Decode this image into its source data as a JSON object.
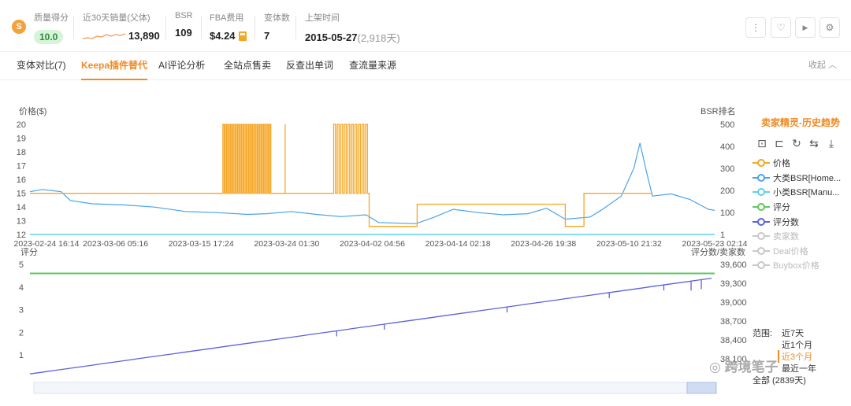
{
  "stats": {
    "logo_glyph": "S",
    "quality": {
      "label": "质量得分",
      "value": "10.0"
    },
    "sales": {
      "label": "近30天销量(父体)",
      "value": "13,890"
    },
    "bsr": {
      "label": "BSR",
      "value": "109"
    },
    "fba": {
      "label": "FBA费用",
      "value": "$4.24"
    },
    "variants": {
      "label": "变体数",
      "value": "7"
    },
    "listing": {
      "label": "上架时间",
      "date": "2015-05-27",
      "days": "(2,918天)"
    }
  },
  "actions": [
    {
      "name": "more-icon",
      "glyph": "⋮"
    },
    {
      "name": "heart-icon",
      "glyph": "♡"
    },
    {
      "name": "video-icon",
      "glyph": "▶"
    },
    {
      "name": "gear-icon",
      "glyph": "⚙"
    }
  ],
  "tabs": [
    {
      "label": "变体对比(7)",
      "active": false
    },
    {
      "label": "Keepa插件替代",
      "active": true
    },
    {
      "label": "AI评论分析",
      "active": false
    },
    {
      "label": "全站点售卖",
      "active": false
    },
    {
      "label": "反查出单词",
      "active": false
    },
    {
      "label": "查流量来源",
      "active": false
    }
  ],
  "collapse_label": "收起",
  "legend": {
    "title": "卖家精灵-历史趋势",
    "items": [
      {
        "label": "价格",
        "color": "#f5a623",
        "on": true
      },
      {
        "label": "大类BSR[Home...",
        "color": "#4aa3ea",
        "on": true
      },
      {
        "label": "小类BSR[Manu...",
        "color": "#5fd0e8",
        "on": true
      },
      {
        "label": "评分",
        "color": "#5cc95c",
        "on": true
      },
      {
        "label": "评分数",
        "color": "#5a62dc",
        "on": true
      },
      {
        "label": "卖家数",
        "color": "#c8c8c8",
        "on": false
      },
      {
        "label": "Deal价格",
        "color": "#c8c8c8",
        "on": false
      },
      {
        "label": "Buybox价格",
        "color": "#c8c8c8",
        "on": false
      }
    ]
  },
  "range": {
    "label": "范围:",
    "options": [
      {
        "label": "近7天",
        "selected": false
      },
      {
        "label": "近1个月",
        "selected": false
      },
      {
        "label": "近3个月",
        "selected": true
      },
      {
        "label": "最近一年",
        "selected": false
      },
      {
        "label": "全部 (2839天)",
        "selected": false
      }
    ]
  },
  "watermark": "跨境笔子",
  "chart_data": [
    {
      "type": "line",
      "ylabel": "价格($)",
      "y2label": "BSR排名",
      "x_ticks": [
        "2023-02-24 16:14",
        "2023-03-06 05:16",
        "2023-03-15 17:24",
        "2023-03-24 01:30",
        "2023-04-02 04:56",
        "2023-04-14 02:18",
        "2023-04-26 19:38",
        "2023-05-10 21:32",
        "2023-05-23 02:14"
      ],
      "xlim": [
        "2023-02-24 16:14",
        "2023-05-23 02:14"
      ],
      "ylim": [
        12,
        20
      ],
      "y_ticks": [
        "12",
        "13",
        "14",
        "15",
        "16",
        "17",
        "18",
        "19",
        "20"
      ],
      "y2lim": [
        1,
        500
      ],
      "y2_ticks": [
        "1",
        "100",
        "200",
        "300",
        "400",
        "500"
      ],
      "series": [
        {
          "name": "价格",
          "axis": "left",
          "color": "#f5a623",
          "segments": [
            {
              "from": 0,
              "to": 0.31,
              "value": 14.99
            },
            {
              "from": 0.31,
              "to": 0.389,
              "value": 14.99,
              "spikes_to": 20,
              "count": 20
            },
            {
              "from": 0.389,
              "to": 0.488,
              "value": 14.99
            },
            {
              "from": 0.488,
              "to": 0.545,
              "value": 14.99,
              "spikes_to": 20,
              "count": 10
            },
            {
              "from": 0.545,
              "to": 0.622,
              "value": 12.59
            },
            {
              "from": 0.622,
              "to": 0.86,
              "value": 14.2
            },
            {
              "from": 0.86,
              "to": 0.89,
              "value": 12.59
            },
            {
              "from": 0.89,
              "to": 1.0,
              "value": 14.99
            }
          ],
          "extra_spike_at": 0.41
        },
        {
          "name": "大类BSR[Home...",
          "axis": "right",
          "color": "#4aa3ea",
          "points": [
            [
              0,
              195
            ],
            [
              0.02,
              205
            ],
            [
              0.05,
              195
            ],
            [
              0.065,
              155
            ],
            [
              0.1,
              140
            ],
            [
              0.15,
              135
            ],
            [
              0.2,
              125
            ],
            [
              0.25,
              105
            ],
            [
              0.3,
              100
            ],
            [
              0.35,
              92
            ],
            [
              0.38,
              95
            ],
            [
              0.42,
              105
            ],
            [
              0.46,
              92
            ],
            [
              0.5,
              82
            ],
            [
              0.54,
              90
            ],
            [
              0.56,
              55
            ],
            [
              0.62,
              50
            ],
            [
              0.65,
              80
            ],
            [
              0.68,
              115
            ],
            [
              0.72,
              100
            ],
            [
              0.76,
              90
            ],
            [
              0.8,
              95
            ],
            [
              0.83,
              120
            ],
            [
              0.86,
              70
            ],
            [
              0.9,
              80
            ],
            [
              0.92,
              115
            ],
            [
              0.95,
              175
            ],
            [
              0.97,
              300
            ],
            [
              0.98,
              415
            ],
            [
              0.99,
              290
            ],
            [
              1.0,
              175
            ],
            [
              1.03,
              185
            ],
            [
              1.06,
              160
            ],
            [
              1.09,
              115
            ],
            [
              1.1,
              110
            ]
          ]
        },
        {
          "name": "小类BSR[Manu...",
          "axis": "right",
          "color": "#5fd0e8",
          "value": 1
        }
      ]
    },
    {
      "type": "line",
      "ylabel": "评分",
      "y2label": "评分数/卖家数",
      "ylim": [
        0,
        5
      ],
      "y_ticks": [
        "1",
        "2",
        "3",
        "4",
        "5"
      ],
      "y2lim": [
        37800,
        39600
      ],
      "y2_ticks": [
        "38,100",
        "38,400",
        "38,700",
        "39,000",
        "39,300",
        "39,600"
      ],
      "series": [
        {
          "name": "评分",
          "axis": "left",
          "color": "#5cc95c",
          "value": 4.6
        },
        {
          "name": "评分数",
          "axis": "right",
          "color": "#5a62dc",
          "start": 37860,
          "end": 39380
        }
      ]
    }
  ]
}
